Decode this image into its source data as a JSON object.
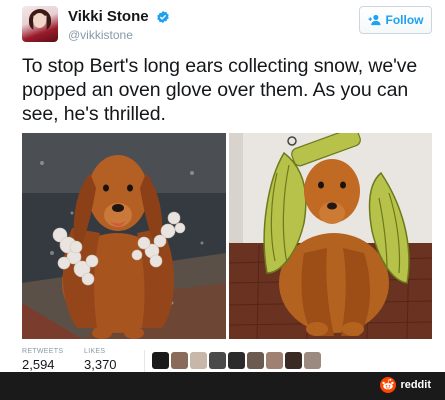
{
  "tweet": {
    "display_name": "Vikki Stone",
    "handle": "@vikkistone",
    "follow_label": "Follow",
    "text": "To stop Bert's long ears collecting snow, we've popped an oven glove over them. As you can see, he's thrilled.",
    "stats": {
      "retweets_label": "RETWEETS",
      "retweets_value": "2,594",
      "likes_label": "LIKES",
      "likes_value": "3,370"
    }
  },
  "footer": {
    "brand_label": "reddit"
  },
  "colors": {
    "twitter_blue": "#1da1f2",
    "reddit_orange": "#ff4500",
    "footer_bg": "#1a1a1b"
  },
  "icons": [
    "verified-badge-icon",
    "follow-person-icon",
    "reddit-alien-icon"
  ]
}
